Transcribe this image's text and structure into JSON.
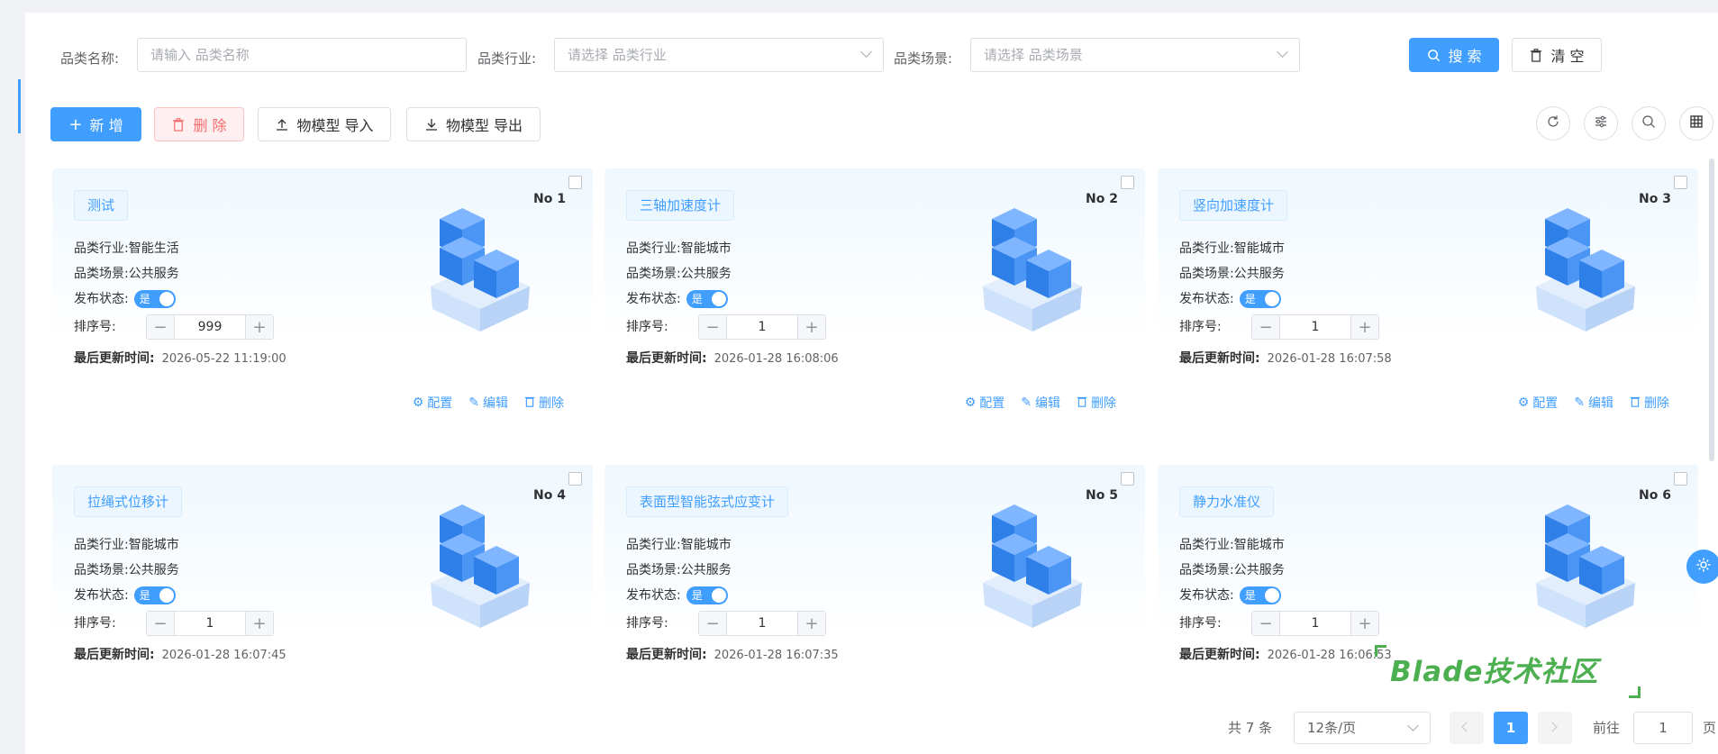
{
  "search": {
    "name_label": "品类名称:",
    "name_placeholder": "请输入 品类名称",
    "industry_label": "品类行业:",
    "industry_placeholder": "请选择 品类行业",
    "scene_label": "品类场景:",
    "scene_placeholder": "请选择 品类场景",
    "search_button": "搜 索",
    "clear_button": "清 空"
  },
  "toolbar": {
    "add_button": "新 增",
    "delete_button": "删 除",
    "import_button": "物模型 导入",
    "export_button": "物模型 导出"
  },
  "cards": [
    {
      "title": "测试",
      "no": "No 1",
      "industry_label": "品类行业:",
      "industry": "智能生活",
      "scene_label": "品类场景:",
      "scene": "公共服务",
      "status_label": "发布状态:",
      "status": "是",
      "sort_label": "排序号:",
      "sort": "999",
      "time_label": "最后更新时间:",
      "time": "2026-05-22 11:19:00",
      "config": "配置",
      "edit": "编辑",
      "delete": "删除"
    },
    {
      "title": "三轴加速度计",
      "no": "No 2",
      "industry_label": "品类行业:",
      "industry": "智能城市",
      "scene_label": "品类场景:",
      "scene": "公共服务",
      "status_label": "发布状态:",
      "status": "是",
      "sort_label": "排序号:",
      "sort": "1",
      "time_label": "最后更新时间:",
      "time": "2026-01-28 16:08:06",
      "config": "配置",
      "edit": "编辑",
      "delete": "删除"
    },
    {
      "title": "竖向加速度计",
      "no": "No 3",
      "industry_label": "品类行业:",
      "industry": "智能城市",
      "scene_label": "品类场景:",
      "scene": "公共服务",
      "status_label": "发布状态:",
      "status": "是",
      "sort_label": "排序号:",
      "sort": "1",
      "time_label": "最后更新时间:",
      "time": "2026-01-28 16:07:58",
      "config": "配置",
      "edit": "编辑",
      "delete": "删除"
    },
    {
      "title": "拉绳式位移计",
      "no": "No 4",
      "industry_label": "品类行业:",
      "industry": "智能城市",
      "scene_label": "品类场景:",
      "scene": "公共服务",
      "status_label": "发布状态:",
      "status": "是",
      "sort_label": "排序号:",
      "sort": "1",
      "time_label": "最后更新时间:",
      "time": "2026-01-28 16:07:45"
    },
    {
      "title": "表面型智能弦式应变计",
      "no": "No 5",
      "industry_label": "品类行业:",
      "industry": "智能城市",
      "scene_label": "品类场景:",
      "scene": "公共服务",
      "status_label": "发布状态:",
      "status": "是",
      "sort_label": "排序号:",
      "sort": "1",
      "time_label": "最后更新时间:",
      "time": "2026-01-28 16:07:35"
    },
    {
      "title": "静力水准仪",
      "no": "No 6",
      "industry_label": "品类行业:",
      "industry": "智能城市",
      "scene_label": "品类场景:",
      "scene": "公共服务",
      "status_label": "发布状态:",
      "status": "是",
      "sort_label": "排序号:",
      "sort": "1",
      "time_label": "最后更新时间:",
      "time": "2026-01-28 16:06:53"
    }
  ],
  "pagination": {
    "total": "共 7 条",
    "page_size": "12条/页",
    "current_page": "1",
    "goto_label": "前往",
    "goto_value": "1",
    "page_unit": "页"
  },
  "watermark": "Blade技术社区",
  "colors": {
    "primary": "#409eff",
    "danger": "#f56c6c",
    "watermark": "#4caf50"
  }
}
